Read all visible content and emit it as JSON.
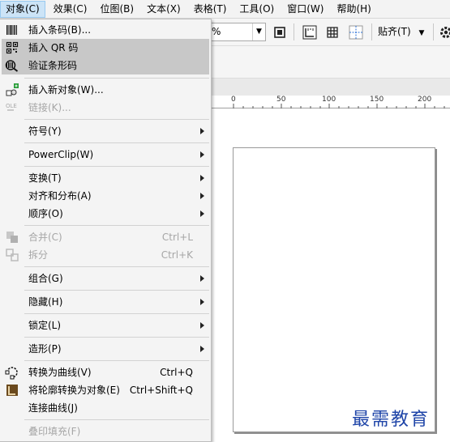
{
  "menubar": [
    {
      "label": "对象(C)",
      "active": true
    },
    {
      "label": "效果(C)"
    },
    {
      "label": "位图(B)"
    },
    {
      "label": "文本(X)"
    },
    {
      "label": "表格(T)"
    },
    {
      "label": "工具(O)"
    },
    {
      "label": "窗口(W)"
    },
    {
      "label": "帮助(H)"
    }
  ],
  "toolbar": {
    "zoom_value": "%",
    "align_label": "贴齐(T)"
  },
  "ruler": {
    "labels": [
      "0",
      "50",
      "100",
      "150",
      "200"
    ]
  },
  "menu": {
    "items": [
      {
        "label": "插入条码(B)...",
        "icon": "barcode-icon"
      },
      {
        "label": "插入 QR 码",
        "icon": "qr-code-icon",
        "highlighted": true
      },
      {
        "label": "验证条形码",
        "icon": "verify-barcode-icon",
        "highlighted": true
      },
      {
        "label": "插入新对象(W)...",
        "icon": "insert-object-icon"
      },
      {
        "label": "链接(K)...",
        "icon": "ole-link-icon",
        "disabled": true
      },
      {
        "label": "符号(Y)",
        "submenu": true
      },
      {
        "label": "PowerClip(W)",
        "submenu": true
      },
      {
        "label": "变换(T)",
        "submenu": true
      },
      {
        "label": "对齐和分布(A)",
        "submenu": true
      },
      {
        "label": "顺序(O)",
        "submenu": true
      },
      {
        "label": "合并(C)",
        "shortcut": "Ctrl+L",
        "icon": "combine-icon",
        "disabled": true
      },
      {
        "label": "拆分",
        "shortcut": "Ctrl+K",
        "icon": "break-apart-icon",
        "disabled": true
      },
      {
        "label": "组合(G)",
        "submenu": true
      },
      {
        "label": "隐藏(H)",
        "submenu": true
      },
      {
        "label": "锁定(L)",
        "submenu": true
      },
      {
        "label": "造形(P)",
        "submenu": true
      },
      {
        "label": "转换为曲线(V)",
        "shortcut": "Ctrl+Q",
        "icon": "convert-to-curves-icon"
      },
      {
        "label": "将轮廓转换为对象(E)",
        "shortcut": "Ctrl+Shift+Q",
        "icon": "outline-to-object-icon"
      },
      {
        "label": "连接曲线(J)"
      },
      {
        "label": "叠印填充(F)",
        "disabled": true
      }
    ]
  },
  "watermark": "最需教育",
  "colors": {
    "highlight": "#c8c8c8",
    "menubar_active": "#cce4f7",
    "watermark": "#1f45a8",
    "disabled_text": "#a6a6a6"
  }
}
